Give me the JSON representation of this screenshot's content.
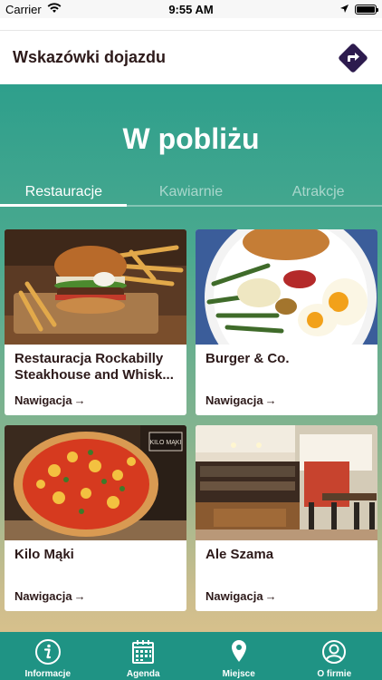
{
  "status_bar": {
    "carrier": "Carrier",
    "time": "9:55 AM",
    "battery_level": 1.0
  },
  "directions": {
    "title": "Wskazówki dojazdu",
    "icon": "directions-arrow-icon",
    "icon_color": "#2d1b4e"
  },
  "main": {
    "title": "W pobliżu",
    "tabs": [
      {
        "label": "Restauracje",
        "active": true
      },
      {
        "label": "Kawiarnie",
        "active": false
      },
      {
        "label": "Atrakcje",
        "active": false
      }
    ]
  },
  "cards": [
    {
      "title": "Restauracja Rockabilly Steakhouse and Whisk...",
      "link": "Nawigacja",
      "image": "burger-photo"
    },
    {
      "title": "Burger & Co.",
      "link": "Nawigacja",
      "image": "food-plate-photo"
    },
    {
      "title": "Kilo Mąki",
      "link": "Nawigacja",
      "image": "pizza-photo"
    },
    {
      "title": "Ale Szama",
      "link": "Nawigacja",
      "image": "restaurant-interior-photo"
    }
  ],
  "tabbar": {
    "items": [
      {
        "label": "Informacje",
        "icon": "info-icon"
      },
      {
        "label": "Agenda",
        "icon": "calendar-icon"
      },
      {
        "label": "Miejsce",
        "icon": "location-pin-icon"
      },
      {
        "label": "O firmie",
        "icon": "user-icon"
      }
    ]
  },
  "colors": {
    "accent": "#1f9384",
    "text_dark": "#2d1a1a",
    "gradient_top": "#2e9f8c",
    "gradient_bottom": "#d7c08c"
  }
}
